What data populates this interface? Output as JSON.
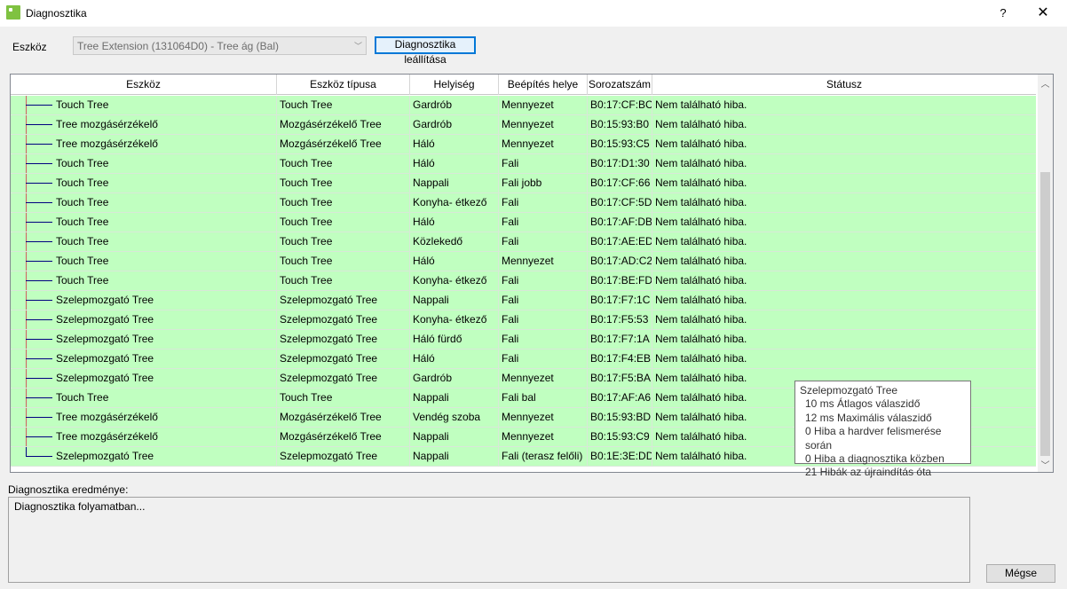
{
  "window": {
    "title": "Diagnosztika",
    "help": "?",
    "close": "✕",
    "icon": "app-leaf-icon"
  },
  "toolbar": {
    "device_label": "Eszköz",
    "device_value": "Tree Extension (131064D0) - Tree ág (Bal)",
    "stop_label": "Diagnosztika leállítása"
  },
  "grid": {
    "headers": [
      "Eszköz",
      "Eszköz típusa",
      "Helyiség",
      "Beépítés helye",
      "Sorozatszám",
      "Státusz"
    ],
    "rows": [
      [
        "Touch Tree",
        "Touch Tree",
        "Gardrób",
        "Mennyezet",
        "B0:17:CF:BC",
        "Nem található hiba."
      ],
      [
        "Tree mozgásérzékelő",
        "Mozgásérzékelő Tree",
        "Gardrób",
        "Mennyezet",
        "B0:15:93:B0",
        "Nem található hiba."
      ],
      [
        "Tree mozgásérzékelő",
        "Mozgásérzékelő Tree",
        "Háló",
        "Mennyezet",
        "B0:15:93:C5",
        "Nem található hiba."
      ],
      [
        "Touch Tree",
        "Touch Tree",
        "Háló",
        "Fali",
        "B0:17:D1:30",
        "Nem található hiba."
      ],
      [
        "Touch Tree",
        "Touch Tree",
        "Nappali",
        "Fali jobb",
        "B0:17:CF:66",
        "Nem található hiba."
      ],
      [
        "Touch Tree",
        "Touch Tree",
        "Konyha- étkező",
        "Fali",
        "B0:17:CF:5D",
        "Nem található hiba."
      ],
      [
        "Touch Tree",
        "Touch Tree",
        "Háló",
        "Fali",
        "B0:17:AF:DB",
        "Nem található hiba."
      ],
      [
        "Touch Tree",
        "Touch Tree",
        "Közlekedő",
        "Fali",
        "B0:17:AE:ED",
        "Nem található hiba."
      ],
      [
        "Touch Tree",
        "Touch Tree",
        "Háló",
        "Mennyezet",
        "B0:17:AD:C2",
        "Nem található hiba."
      ],
      [
        "Touch Tree",
        "Touch Tree",
        "Konyha- étkező",
        "Fali",
        "B0:17:BE:FD",
        "Nem található hiba."
      ],
      [
        "Szelepmozgató Tree",
        "Szelepmozgató Tree",
        "Nappali",
        "Fali",
        "B0:17:F7:1C",
        "Nem található hiba."
      ],
      [
        "Szelepmozgató Tree",
        "Szelepmozgató Tree",
        "Konyha- étkező",
        "Fali",
        "B0:17:F5:53",
        "Nem található hiba."
      ],
      [
        "Szelepmozgató Tree",
        "Szelepmozgató Tree",
        "Háló fürdő",
        "Fali",
        "B0:17:F7:1A",
        "Nem található hiba."
      ],
      [
        "Szelepmozgató Tree",
        "Szelepmozgató Tree",
        "Háló",
        "Fali",
        "B0:17:F4:EB",
        "Nem található hiba."
      ],
      [
        "Szelepmozgató Tree",
        "Szelepmozgató Tree",
        "Gardrób",
        "Mennyezet",
        "B0:17:F5:BA",
        "Nem található hiba."
      ],
      [
        "Touch Tree",
        "Touch Tree",
        "Nappali",
        "Fali bal",
        "B0:17:AF:A6",
        "Nem található hiba."
      ],
      [
        "Tree mozgásérzékelő",
        "Mozgásérzékelő Tree",
        "Vendég szoba",
        "Mennyezet",
        "B0:15:93:BD",
        "Nem található hiba."
      ],
      [
        "Tree mozgásérzékelő",
        "Mozgásérzékelő Tree",
        "Nappali",
        "Mennyezet",
        "B0:15:93:C9",
        "Nem található hiba."
      ],
      [
        "Szelepmozgató Tree",
        "Szelepmozgató Tree",
        "Nappali",
        "Fali (terasz felőli)",
        "B0:1E:3E:DD",
        "Nem található hiba."
      ]
    ]
  },
  "tooltip": {
    "title": "Szelepmozgató Tree",
    "lines": [
      "10 ms Átlagos válaszidő",
      "12 ms Maximális válaszidő",
      "0 Hiba a hardver felismerése során",
      "0 Hiba a diagnosztika közben",
      "21 Hibák az újraindítás óta"
    ]
  },
  "result": {
    "label": "Diagnosztika eredménye:",
    "text": "Diagnosztika folyamatban..."
  },
  "footer": {
    "cancel_label": "Mégse"
  },
  "colors": {
    "row_ok": "#c0ffc0",
    "accent": "#0078d7"
  }
}
